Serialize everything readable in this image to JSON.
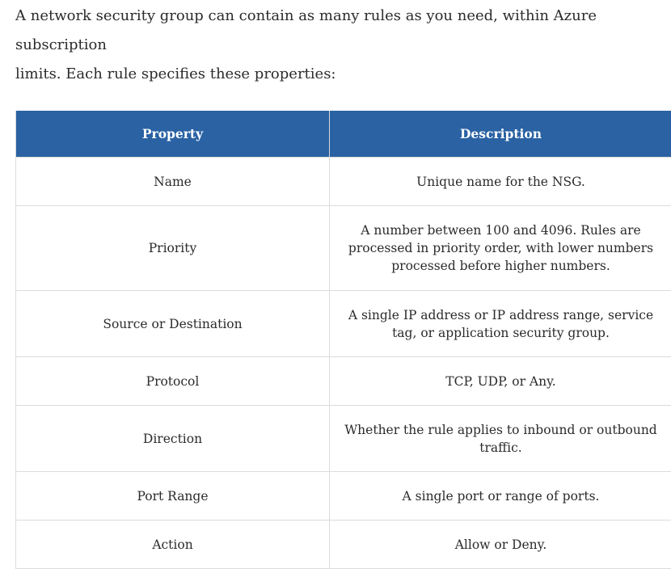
{
  "intro": {
    "line1": "A network security group can contain as many rules as you need, within Azure subscription",
    "line2": "limits. Each rule specifies these properties:"
  },
  "table": {
    "headers": {
      "property": "Property",
      "description": "Description"
    },
    "rows": [
      {
        "property": "Name",
        "description": "Unique name for the NSG."
      },
      {
        "property": "Priority",
        "description": "A number between 100 and 4096. Rules are processed in priority order, with lower numbers processed before higher numbers."
      },
      {
        "property": "Source or Destination",
        "description": "A single IP address or IP address range, service tag, or application security group."
      },
      {
        "property": "Protocol",
        "description": "TCP, UDP, or Any."
      },
      {
        "property": "Direction",
        "description": "Whether the rule applies to inbound or outbound traffic."
      },
      {
        "property": "Port Range",
        "description": "A single port or range of ports."
      },
      {
        "property": "Action",
        "description": "Allow or Deny."
      }
    ]
  },
  "colors": {
    "header_background": "#2a62a3",
    "header_text": "#ffffff",
    "border": "#dcdcdc"
  }
}
